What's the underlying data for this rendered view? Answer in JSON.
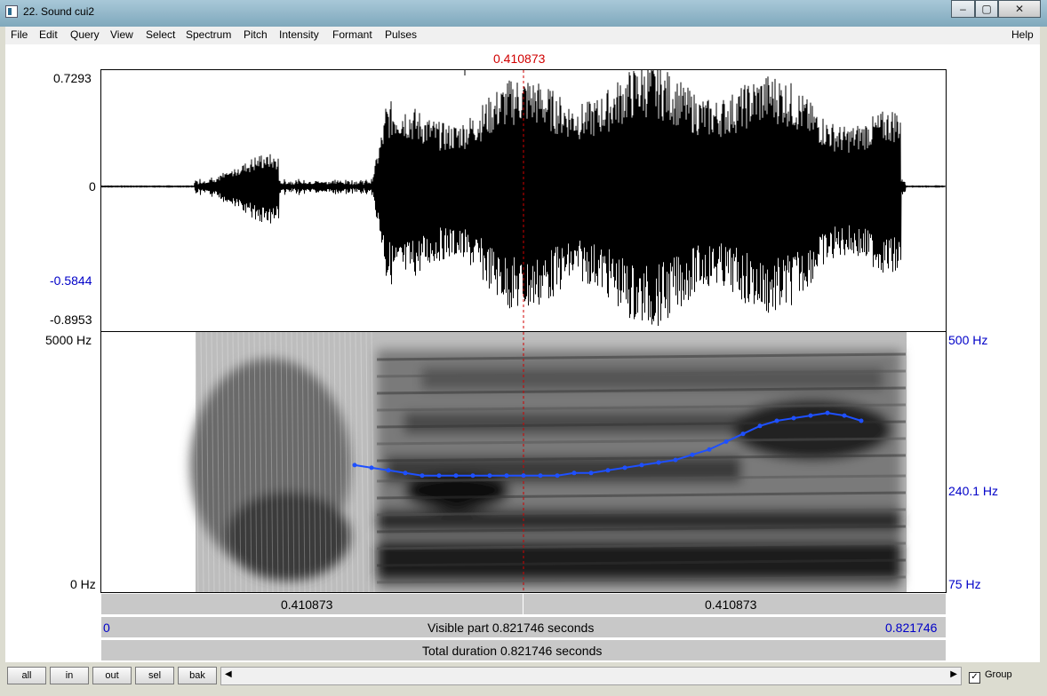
{
  "window": {
    "title": "22. Sound cui2",
    "minimize": "–",
    "maximize": "▢",
    "close": "✕"
  },
  "menu": [
    "File",
    "Edit",
    "Query",
    "View",
    "Select",
    "Spectrum",
    "Pitch",
    "Intensity",
    "Formant",
    "Pulses"
  ],
  "help": "Help",
  "cursor_time": "0.410873",
  "waveform": {
    "max": "0.7293",
    "zero": "0",
    "cursor_value": "-0.5844",
    "min": "-0.8953"
  },
  "spectrogram": {
    "freq_top": "5000 Hz",
    "freq_bottom": "0 Hz",
    "pitch_top": "500 Hz",
    "pitch_value": "240.1 Hz",
    "pitch_bottom": "75 Hz"
  },
  "time_bar": {
    "left": "0.410873",
    "right": "0.410873"
  },
  "visible_bar": {
    "start": "0",
    "label": "Visible part 0.821746 seconds",
    "end": "0.821746"
  },
  "total_bar": {
    "label": "Total duration 0.821746 seconds"
  },
  "nav_buttons": [
    "all",
    "in",
    "out",
    "sel",
    "bak"
  ],
  "scroll": {
    "left_arrow": "◀",
    "right_arrow": "▶"
  },
  "group": {
    "label": "Group",
    "checked": "✓"
  },
  "colors": {
    "pitch": "#1e50ff",
    "cursor": "#d00000"
  },
  "pitch_points": [
    [
      0.3,
      0.51
    ],
    [
      0.32,
      0.52
    ],
    [
      0.34,
      0.53
    ],
    [
      0.36,
      0.54
    ],
    [
      0.38,
      0.55
    ],
    [
      0.4,
      0.55
    ],
    [
      0.42,
      0.55
    ],
    [
      0.44,
      0.55
    ],
    [
      0.46,
      0.55
    ],
    [
      0.48,
      0.55
    ],
    [
      0.5,
      0.55
    ],
    [
      0.52,
      0.55
    ],
    [
      0.54,
      0.55
    ],
    [
      0.56,
      0.54
    ],
    [
      0.58,
      0.54
    ],
    [
      0.6,
      0.53
    ],
    [
      0.62,
      0.52
    ],
    [
      0.64,
      0.51
    ],
    [
      0.66,
      0.5
    ],
    [
      0.68,
      0.49
    ],
    [
      0.7,
      0.47
    ],
    [
      0.72,
      0.45
    ],
    [
      0.74,
      0.42
    ],
    [
      0.76,
      0.39
    ],
    [
      0.78,
      0.36
    ],
    [
      0.8,
      0.34
    ],
    [
      0.82,
      0.33
    ],
    [
      0.84,
      0.32
    ],
    [
      0.86,
      0.31
    ],
    [
      0.88,
      0.32
    ],
    [
      0.9,
      0.34
    ]
  ]
}
